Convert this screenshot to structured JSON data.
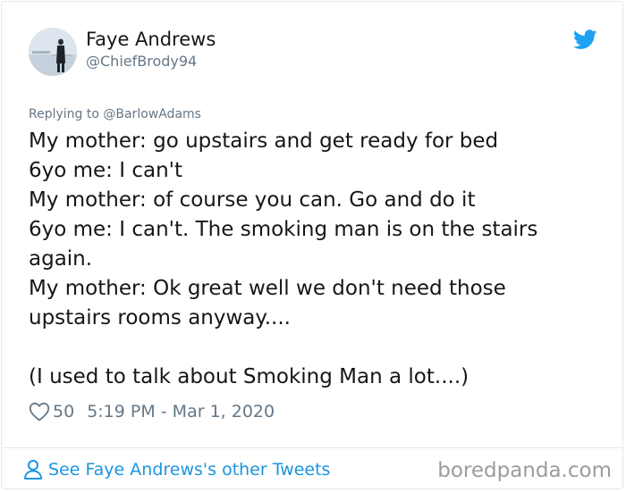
{
  "author": {
    "display_name": "Faye Andrews",
    "handle": "@ChiefBrody94",
    "avatar_icon": "profile-photo"
  },
  "reply": {
    "text": "Replying to @BarlowAdams"
  },
  "tweet": {
    "lines": [
      "My mother: go upstairs and get ready for bed",
      "6yo me: I can't",
      "My mother: of course you can. Go and do it",
      "6yo me: I can't. The smoking man is on the stairs",
      "again.",
      "My mother: Ok great well we don't need those",
      "upstairs rooms anyway....",
      "",
      "(I used to talk about Smoking Man a lot....)"
    ]
  },
  "meta": {
    "likes": "50",
    "timestamp": "5:19 PM - Mar 1, 2020"
  },
  "footer": {
    "other_tweets_label": "See Faye Andrews's other Tweets",
    "watermark": "boredpanda.com"
  },
  "colors": {
    "twitter_blue": "#1da1f2",
    "link_blue": "#1b95e0",
    "secondary_text": "#657786"
  },
  "icons": {
    "brand": "twitter-bird-icon",
    "like": "heart-icon",
    "profile": "person-icon"
  }
}
